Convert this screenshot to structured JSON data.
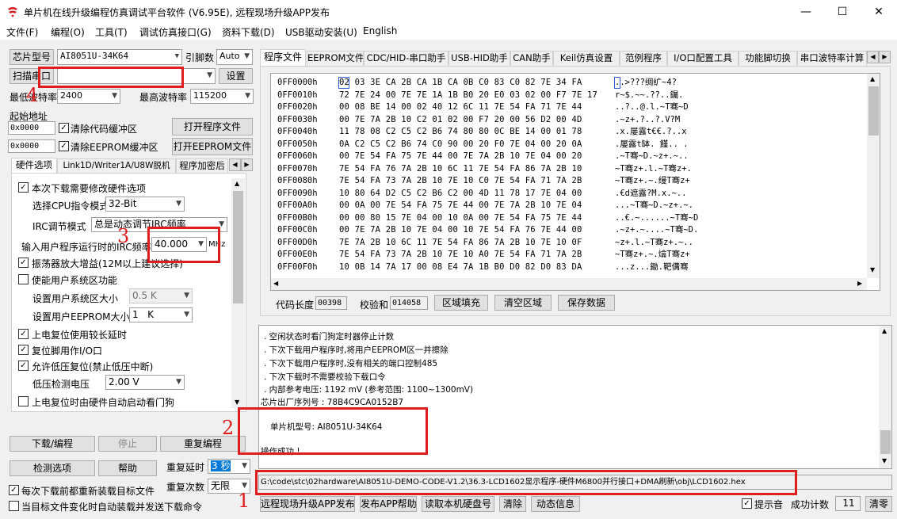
{
  "window": {
    "title": "单片机在线升级编程仿真调试平台软件 (V6.95E), 远程现场升级APP发布",
    "min": "—",
    "max": "☐",
    "close": "✕",
    "accent": "#e01c1c"
  },
  "menu": [
    "文件(F)",
    "编程(O)",
    "工具(T)",
    "调试仿真接口(G)",
    "资料下载(D)",
    "USB驱动安装(U)",
    "English"
  ],
  "left": {
    "chip_label": "芯片型号",
    "chip_value": "AI8051U-34K64",
    "pins_label": "引脚数",
    "pins_value": "Auto",
    "scan_button": "扫描串口",
    "port_value": "",
    "settings_button": "设置",
    "min_baud_label": "最低波特率",
    "min_baud": "2400",
    "max_baud_label": "最高波特率",
    "max_baud": "115200",
    "start_addr_label": "起始地址",
    "code_addr": "0x0000",
    "clear_code": "清除代码缓冲区",
    "open_program": "打开程序文件",
    "eeprom_addr": "0x0000",
    "clear_eeprom": "清除EEPROM缓冲区",
    "open_eeprom": "打开EEPROM文件",
    "tabs": [
      "硬件选项",
      "Link1D/Writer1A/U8W脱机",
      "程序加密后"
    ],
    "options": {
      "modify_hw": "本次下载需要修改硬件选项",
      "cpu_label": "选择CPU指令模式",
      "cpu_value": "32-Bit",
      "irc_label": "IRC调节模式",
      "irc_value": "总是动态调节IRC频率",
      "freq_label": "输入用户程序运行时的IRC频率",
      "freq_value": "40.000",
      "freq_unit": "MHz",
      "osc_gain": "振荡器放大增益(12M以上建议选择)",
      "sys_area": "使能用户系统区功能",
      "sys_size_label": "设置用户系统区大小",
      "sys_size": "0.5 K",
      "eeprom_size_label": "设置用户EEPROM大小",
      "eeprom_size": "1   K",
      "long_delay": "上电复位使用较长延时",
      "reset_io": "复位脚用作I/O口",
      "lvr": "允许低压复位(禁止低压中断)",
      "lvd_label": "低压检测电压",
      "lvd_value": "2.00 V",
      "wdt": "上电复位时由硬件自动启动看门狗"
    },
    "download_button": "下载/编程",
    "stop_button": "停止",
    "redownload_button": "重复编程",
    "check_button": "检测选项",
    "help_button": "帮助",
    "repeat_delay_label": "重复延时",
    "repeat_delay": "3 秒",
    "repeat_count_label": "重复次数",
    "repeat_count": "无限",
    "reload_before": "每次下载前都重新装载目标文件",
    "auto_send": "当目标文件变化时自动装载并发送下载命令"
  },
  "right": {
    "tabs": [
      "程序文件",
      "EEPROM文件",
      "CDC/HID-串口助手",
      "USB-HID助手",
      "CAN助手",
      "Keil仿真设置",
      "范例程序",
      "I/O口配置工具",
      "功能脚切换",
      "串口波特率计算"
    ],
    "hex_rows": [
      {
        "addr": "0FF0000h",
        "bytes": "02 03 3E CA 2B CA 1B CA 0B C0 83 C0 82 7E 34 FA",
        "ascii": "..>???绸纩~4?"
      },
      {
        "addr": "0FF0010h",
        "bytes": "72 7E 24 00 7E 7E 1A 1B B0 20 E0 03 02 00 F7 7E 17",
        "ascii": "r~$.~~.??..钃."
      },
      {
        "addr": "0FF0020h",
        "bytes": "00 08 BE 14 00 02 40 12 6C 11 7E 54 FA 71 7E 44",
        "ascii": "..?..@.l.~T骞~D"
      },
      {
        "addr": "0FF0030h",
        "bytes": "00 7E 7A 2B 10 C2 01 02 00 F7 20 00 56 D2 00 4D",
        "ascii": ".~z+.?..?.V?M"
      },
      {
        "addr": "0FF0040h",
        "bytes": "11 78 08 C2 C5 C2 B6 74 80 80 0C BE 14 00 01 78",
        "ascii": ".x.屡露t€€.?..x"
      },
      {
        "addr": "0FF0050h",
        "bytes": "0A C2 C5 C2 B6 74 C0 90 00 20 F0 7E 04 00 20 0A",
        "ascii": ".屡露t缽. 饉.. ."
      },
      {
        "addr": "0FF0060h",
        "bytes": "00 7E 54 FA 75 7E 44 00 7E 7A 2B 10 7E 04 00 20",
        "ascii": ".~T骞~D.~z+.~.."
      },
      {
        "addr": "0FF0070h",
        "bytes": "7E 54 FA 76 7A 2B 10 6C 11 7E 54 FA 86 7A 2B 10",
        "ascii": "~T骞z+.l.~T骞z+."
      },
      {
        "addr": "0FF0080h",
        "bytes": "7E 54 FA 73 7A 2B 10 7E 10 C0 7E 54 FA 71 7A 2B",
        "ascii": "~T骞z+.~.缦T骞z+"
      },
      {
        "addr": "0FF0090h",
        "bytes": "10 80 64 D2 C5 C2 B6 C2 00 4D 11 78 17 7E 04 00",
        "ascii": ".€d遮露?M.x.~.."
      },
      {
        "addr": "0FF00A0h",
        "bytes": "00 0A 00 7E 54 FA 75 7E 44 00 7E 7A 2B 10 7E 04",
        "ascii": "...~T骞~D.~z+.~."
      },
      {
        "addr": "0FF00B0h",
        "bytes": "00 00 80 15 7E 04 00 10 0A 00 7E 54 FA 75 7E 44",
        "ascii": "..€.~......~T骞~D"
      },
      {
        "addr": "0FF00C0h",
        "bytes": "00 7E 7A 2B 10 7E 04 00 10 7E 54 FA 76 7E 44 00",
        "ascii": ".~z+.~....~T骞~D."
      },
      {
        "addr": "0FF00D0h",
        "bytes": "7E 7A 2B 10 6C 11 7E 54 FA 86 7A 2B 10 7E 10 0F",
        "ascii": "~z+.l.~T骞z+.~.."
      },
      {
        "addr": "0FF00E0h",
        "bytes": "7E 54 FA 73 7A 2B 10 7E 10 A0 7E 54 FA 71 7A 2B",
        "ascii": "~T骞z+.~.爚T骞z+"
      },
      {
        "addr": "0FF00F0h",
        "bytes": "10 0B 14 7A 17 00 08 E4 7A 1B B0 D0 82 D0 83 DA",
        "ascii": "...z...鋤.靶傋骞"
      }
    ],
    "code_len_label": "代码长度",
    "code_len": "00398",
    "checksum_label": "校验和",
    "checksum": "014058",
    "fill_button": "区域填充",
    "clear_button": "清空区域",
    "save_button": "保存数据",
    "log_lines": [
      ". 空闲状态时看门狗定时器停止计数",
      ". 下次下载用户程序时,将用户EEPROM区一并擦除",
      ". 下次下载用户程序时,没有相关的端口控制485",
      ". 下次下载时不需要校验下载口令",
      ". 内部参考电压: 1192 mV (参考范围: 1100~1300mV)",
      "芯片出厂序列号 : 78B4C9CA0152B7",
      "",
      "单片机型号: AI8051U-34K64",
      "",
      "操作成功 !"
    ],
    "file_path": "G:\\code\\stc\\02hardware\\AI8051U-DEMO-CODE-V1.2\\36.3-LCD1602显示程序-硬件M6800并行接口+DMA刷新\\obj\\LCD1602.hex",
    "bottom_buttons": [
      "远程现场升级APP发布",
      "发布APP帮助",
      "读取本机硬盘号",
      "清除",
      "动态信息"
    ],
    "beep_label": "提示音",
    "success_label": "成功计数",
    "success_count": "11",
    "clear_count_button": "清零"
  },
  "annotations": [
    "1",
    "2",
    "3",
    "4"
  ]
}
